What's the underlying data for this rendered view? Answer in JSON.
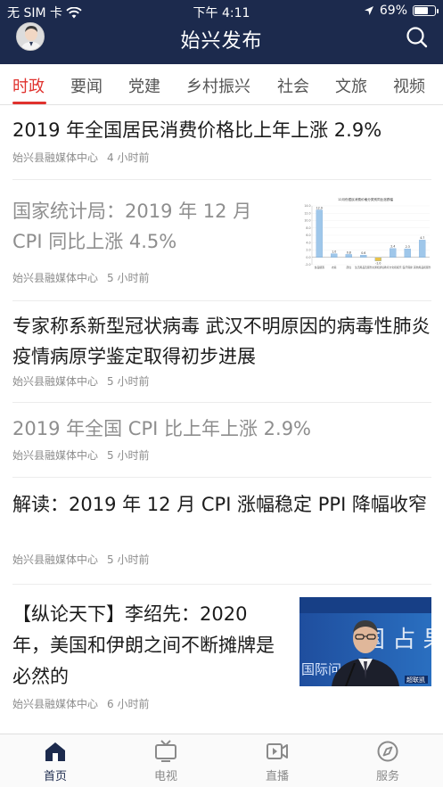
{
  "status_bar": {
    "carrier": "无 SIM 卡",
    "time": "下午 4:11",
    "battery": "69%",
    "battery_level": 0.69
  },
  "header": {
    "title": "始兴发布"
  },
  "tabs": [
    {
      "label": "时政",
      "active": true
    },
    {
      "label": "要闻"
    },
    {
      "label": "党建"
    },
    {
      "label": "乡村振兴"
    },
    {
      "label": "社会"
    },
    {
      "label": "文旅"
    },
    {
      "label": "视频"
    }
  ],
  "feed": [
    {
      "title": "2019 年全国居民消费价格比上年上涨 2.9%",
      "source": "始兴县融媒体中心",
      "time": "4 小时前"
    },
    {
      "title": "国家统计局：2019 年 12 月 CPI 同比上涨 4.5%",
      "source": "始兴县融媒体中心",
      "time": "5 小时前",
      "read": true,
      "thumb_chart": {
        "type": "bar",
        "title": "12月份居民消费价格分类别同比涨跌幅",
        "categories": [
          "食品烟酒",
          "衣着",
          "居住",
          "生活用品及服务",
          "交通和通信",
          "教育文化和娱乐",
          "医疗保健",
          "其他用品和服务"
        ],
        "values": [
          12.9,
          1.0,
          0.8,
          0.6,
          -1.0,
          2.4,
          2.3,
          4.7
        ],
        "labels": [
          "12.9",
          "1.0",
          "0.8",
          "0.6",
          "-1.0",
          "2.4",
          "2.3",
          "4.7"
        ],
        "ylim": [
          -2.0,
          14.0
        ],
        "ticks": [
          "14.0",
          "12.0",
          "10.0",
          "8.0",
          "6.0",
          "4.0",
          "2.0",
          "0.0",
          "-2.0"
        ]
      }
    },
    {
      "title": "专家称系新型冠状病毒 武汉不明原因的病毒性肺炎疫情病原学鉴定取得初步进展",
      "source": "始兴县融媒体中心",
      "time": "5 小时前"
    },
    {
      "title": "2019 年全国 CPI 比上年上涨 2.9%",
      "source": "始兴县融媒体中心",
      "time": "5 小时前",
      "read": true
    },
    {
      "title": "解读：2019 年 12 月 CPI 涨幅稳定 PPI 降幅收窄",
      "source": "始兴县融媒体中心",
      "time": "5 小时前"
    },
    {
      "title": "【纵论天下】李绍先：2020 年，美国和伊朗之间不断摊牌是必然的",
      "source": "始兴县融媒体中心",
      "time": "6 小时前",
      "thumb_photo": {
        "backdrop_text": "国 占 果",
        "backdrop_sub": "国际问",
        "logo": "超联凯"
      }
    }
  ],
  "bottom_nav": [
    {
      "label": "首页",
      "icon": "home-icon",
      "active": true
    },
    {
      "label": "电视",
      "icon": "tv-icon"
    },
    {
      "label": "直播",
      "icon": "live-video-icon"
    },
    {
      "label": "服务",
      "icon": "compass-icon"
    }
  ],
  "colors": {
    "header_bg": "#1c2a4d",
    "accent": "#e0322e",
    "chart_bar": "#9fc7ea"
  }
}
